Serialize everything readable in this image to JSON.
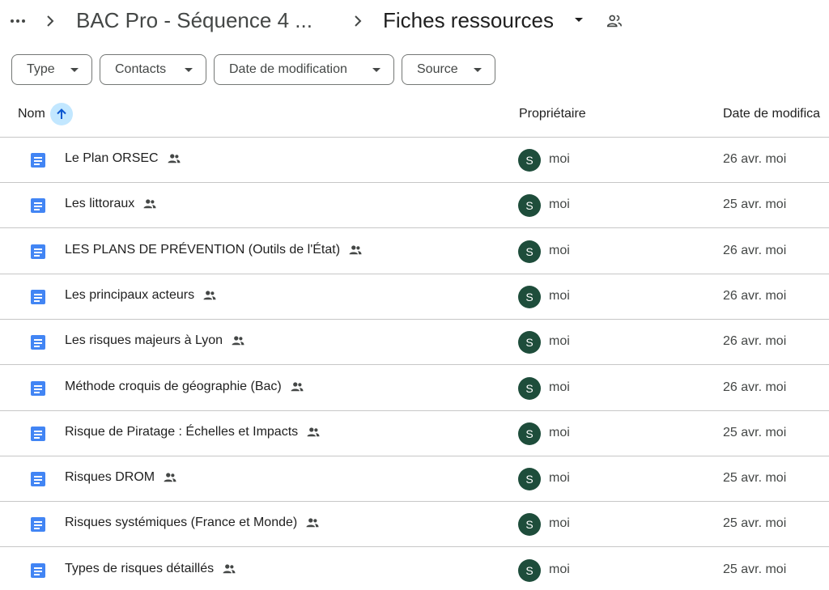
{
  "breadcrumb": {
    "parent": "BAC Pro - Séquence 4 ...",
    "current": "Fiches ressources"
  },
  "filters": [
    "Type",
    "Contacts",
    "Date de modification",
    "Source"
  ],
  "columns": {
    "name": "Nom",
    "owner": "Propriétaire",
    "date": "Date de modifica"
  },
  "files": [
    {
      "name": "Le Plan ORSEC",
      "avatar": "S",
      "owner": "moi",
      "date": "26 avr. moi"
    },
    {
      "name": "Les littoraux",
      "avatar": "S",
      "owner": "moi",
      "date": "25 avr. moi"
    },
    {
      "name": "LES PLANS DE PRÉVENTION (Outils de l'État)",
      "avatar": "S",
      "owner": "moi",
      "date": "26 avr. moi"
    },
    {
      "name": "Les principaux acteurs",
      "avatar": "S",
      "owner": "moi",
      "date": "26 avr. moi"
    },
    {
      "name": "Les risques majeurs à Lyon",
      "avatar": "S",
      "owner": "moi",
      "date": "26 avr. moi"
    },
    {
      "name": "Méthode croquis de géographie (Bac)",
      "avatar": "S",
      "owner": "moi",
      "date": "26 avr. moi"
    },
    {
      "name": "Risque de Piratage : Échelles et Impacts",
      "avatar": "S",
      "owner": "moi",
      "date": "25 avr. moi"
    },
    {
      "name": "Risques DROM",
      "avatar": "S",
      "owner": "moi",
      "date": "25 avr. moi"
    },
    {
      "name": "Risques systémiques (France et Monde)",
      "avatar": "S",
      "owner": "moi",
      "date": "25 avr. moi"
    },
    {
      "name": "Types de risques détaillés",
      "avatar": "S",
      "owner": "moi",
      "date": "25 avr. moi"
    }
  ],
  "icons": {
    "file": "google-docs-icon",
    "shared": "people-icon",
    "sort": "arrow-up-icon"
  },
  "colors": {
    "doc_blue": "#4285f4",
    "avatar_bg": "#1e4d3b",
    "sort_highlight": "#c2e7ff"
  }
}
